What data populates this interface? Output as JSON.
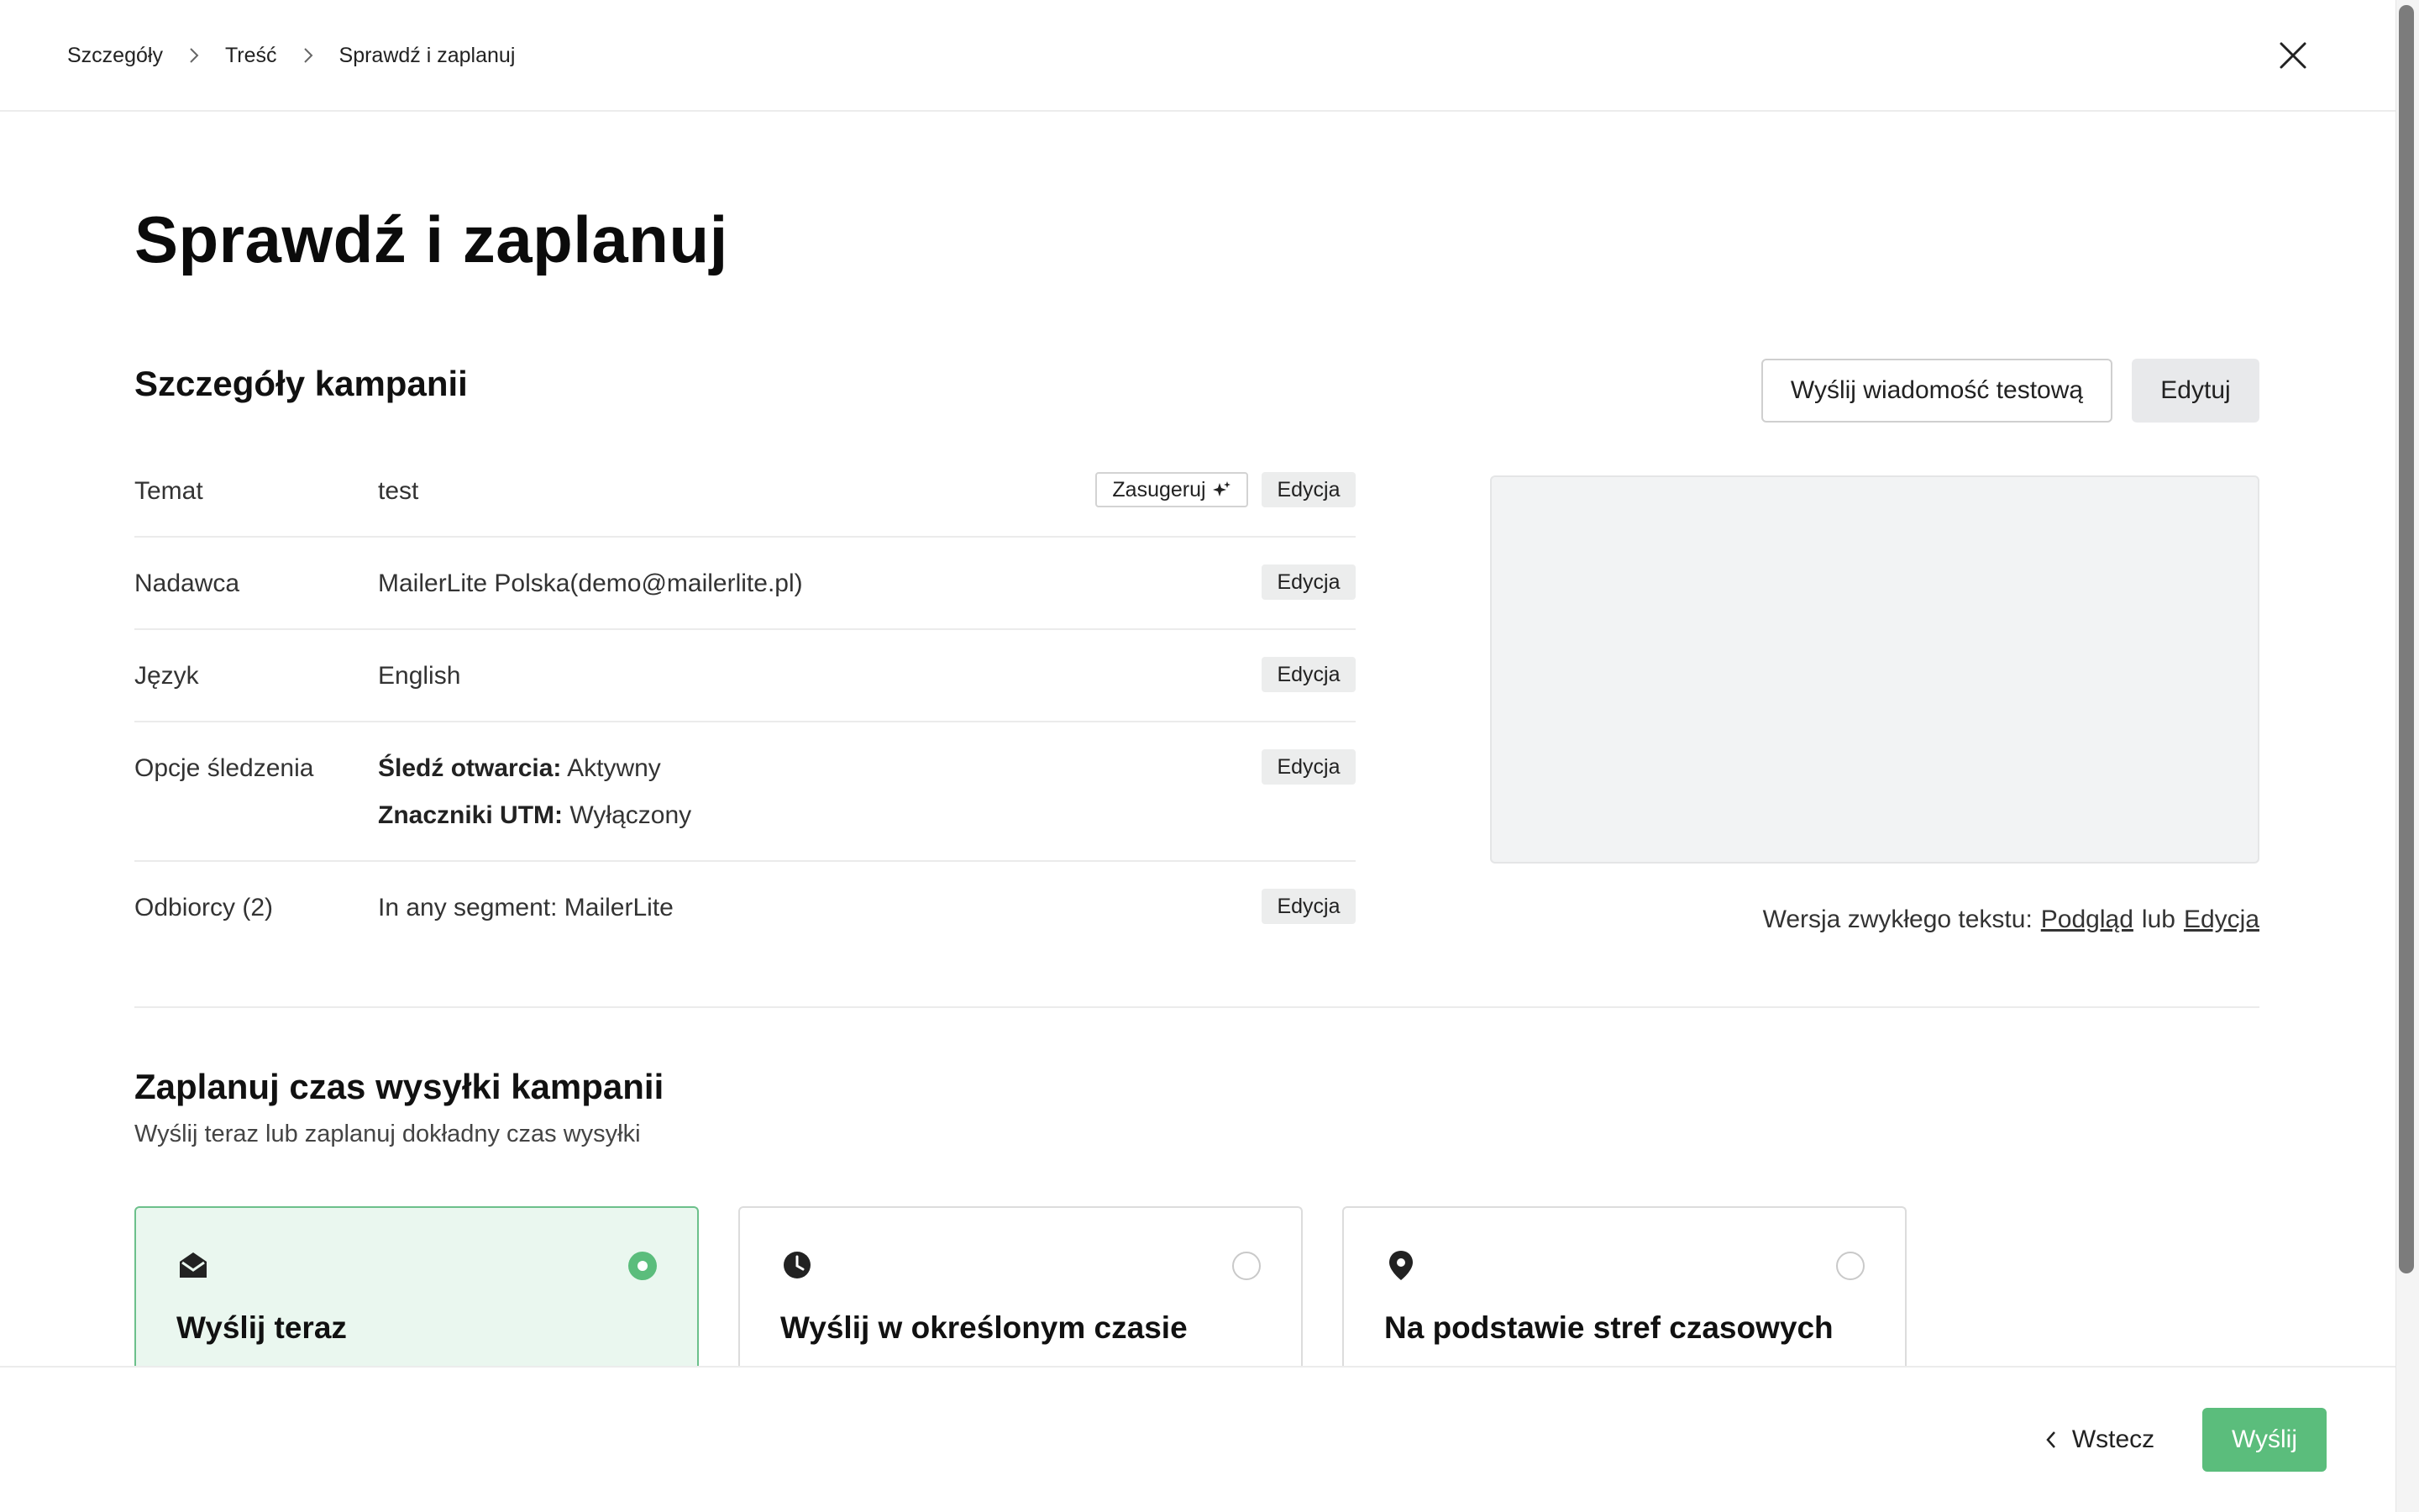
{
  "breadcrumb": {
    "items": [
      "Szczegóły",
      "Treść",
      "Sprawdź i zaplanuj"
    ]
  },
  "page": {
    "title": "Sprawdź i zaplanuj"
  },
  "details": {
    "section_title": "Szczegóły kampanii",
    "send_test_label": "Wyślij wiadomość testową",
    "edit_label": "Edytuj",
    "suggest_label": "Zasugeruj",
    "row_edit_label": "Edycja",
    "rows": [
      {
        "label": "Temat",
        "value": "test"
      },
      {
        "label": "Nadawca",
        "value": "MailerLite Polska(demo@mailerlite.pl)"
      },
      {
        "label": "Język",
        "value": "English"
      },
      {
        "label": "Opcje śledzenia",
        "tracking_opens_label": "Śledź otwarcia:",
        "tracking_opens_value": "Aktywny",
        "utm_label": "Znaczniki UTM:",
        "utm_value": "Wyłączony"
      },
      {
        "label": "Odbiorcy (2)",
        "value": "In any segment: MailerLite"
      }
    ]
  },
  "plain_text": {
    "prefix": "Wersja zwykłego tekstu:",
    "preview_link": "Podgląd",
    "or": "lub",
    "edit_link": "Edycja"
  },
  "schedule": {
    "title": "Zaplanuj czas wysyłki kampanii",
    "subtitle": "Wyślij teraz lub zaplanuj dokładny czas wysyłki",
    "options": [
      {
        "label": "Wyślij teraz",
        "icon": "envelope-open-icon",
        "selected": true
      },
      {
        "label": "Wyślij w określonym czasie",
        "icon": "clock-icon",
        "selected": false
      },
      {
        "label": "Na podstawie stref czasowych",
        "icon": "map-pin-icon",
        "selected": false
      }
    ]
  },
  "footer": {
    "back_label": "Wstecz",
    "send_label": "Wyślij"
  },
  "colors": {
    "accent_green": "#5bbd7c",
    "selected_card_bg": "#eaf7ef"
  }
}
